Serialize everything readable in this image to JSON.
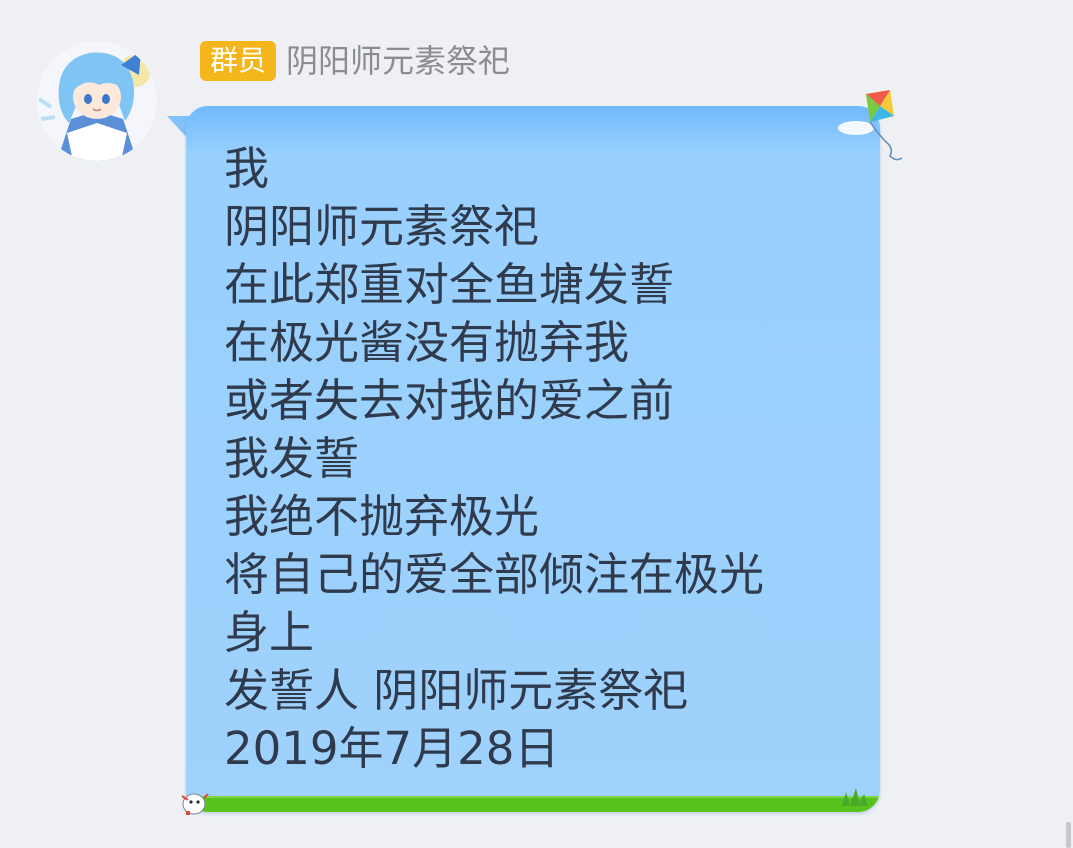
{
  "chat": {
    "sender_badge": "群员",
    "sender_name": "阴阳师元素祭祀",
    "avatar_icon": "anime-avatar-icon",
    "message_lines": [
      "我",
      "阴阳师元素祭祀",
      "在此郑重对全鱼塘发誓",
      "在极光酱没有抛弃我",
      "或者失去对我的爱之前",
      "我发誓",
      "我绝不抛弃极光",
      "将自己的爱全部倾注在极光",
      "身上",
      "发誓人 阴阳师元素祭祀",
      "2019年7月28日"
    ],
    "bubble_decorations": [
      "kite-icon",
      "mascot-icon",
      "plant-icon"
    ]
  },
  "colors": {
    "page_background": "#eef0f4",
    "badge_background": "#f5b61c",
    "bubble_background": "#9fd2fd",
    "message_text": "#2f3a4c",
    "grass": "#56c21c"
  }
}
